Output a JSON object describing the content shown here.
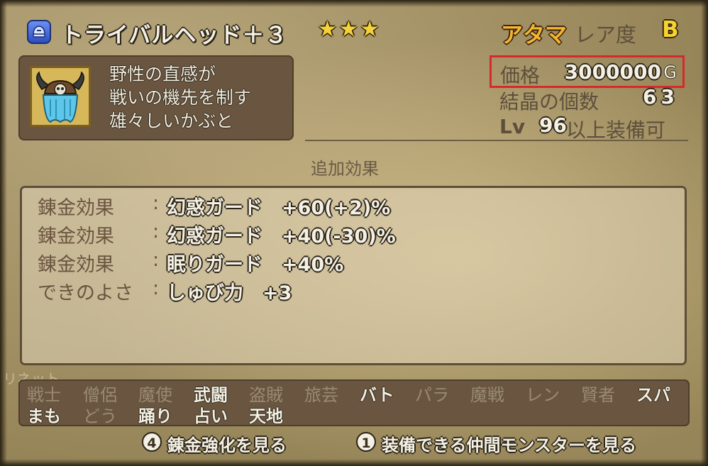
{
  "item": {
    "category_icon": "helmet-icon",
    "name": "トライバルヘッド＋３",
    "stars": "★★★",
    "slot": "アタマ",
    "rarity_label": "レア度",
    "rarity_value": "B",
    "icon": "horned-helmet-icon",
    "description": [
      "野性の直感が",
      "戦いの機先を制す",
      "雄々しいかぶと"
    ]
  },
  "stats": {
    "price_label": "価格",
    "price_value": "3000000",
    "price_unit": "G",
    "crystal_label": "結晶の個数",
    "crystal_value": "63",
    "level_prefix": "Lv",
    "level_value": "96",
    "level_suffix": "以上装備可"
  },
  "effects": {
    "heading": "追加効果",
    "rows": [
      {
        "label": "錬金効果",
        "value": "幻惑ガード　+60(+2)%"
      },
      {
        "label": "錬金効果",
        "value": "幻惑ガード　+40(-30)%"
      },
      {
        "label": "錬金効果",
        "value": "眠りガード　+40%"
      },
      {
        "label": "できのよさ",
        "value": "しゅび力　+3"
      }
    ]
  },
  "faint_text": "リネット",
  "jobs": {
    "row1": [
      {
        "label": "戦士",
        "enabled": false
      },
      {
        "label": "僧侶",
        "enabled": false
      },
      {
        "label": "魔使",
        "enabled": false
      },
      {
        "label": "武闘",
        "enabled": true
      },
      {
        "label": "盗賊",
        "enabled": false
      },
      {
        "label": "旅芸",
        "enabled": false
      },
      {
        "label": "バト",
        "enabled": true
      },
      {
        "label": "パラ",
        "enabled": false
      },
      {
        "label": "魔戦",
        "enabled": false
      },
      {
        "label": "レン",
        "enabled": false
      },
      {
        "label": "賢者",
        "enabled": false
      },
      {
        "label": "スパ",
        "enabled": true
      }
    ],
    "row2": [
      {
        "label": "まも",
        "enabled": true
      },
      {
        "label": "どう",
        "enabled": false
      },
      {
        "label": "踊り",
        "enabled": true
      },
      {
        "label": "占い",
        "enabled": true
      },
      {
        "label": "天地",
        "enabled": true
      }
    ]
  },
  "hints": [
    {
      "button": "4",
      "label": "錬金強化を見る"
    },
    {
      "button": "1",
      "label": "装備できる仲間モンスターを見る"
    }
  ]
}
